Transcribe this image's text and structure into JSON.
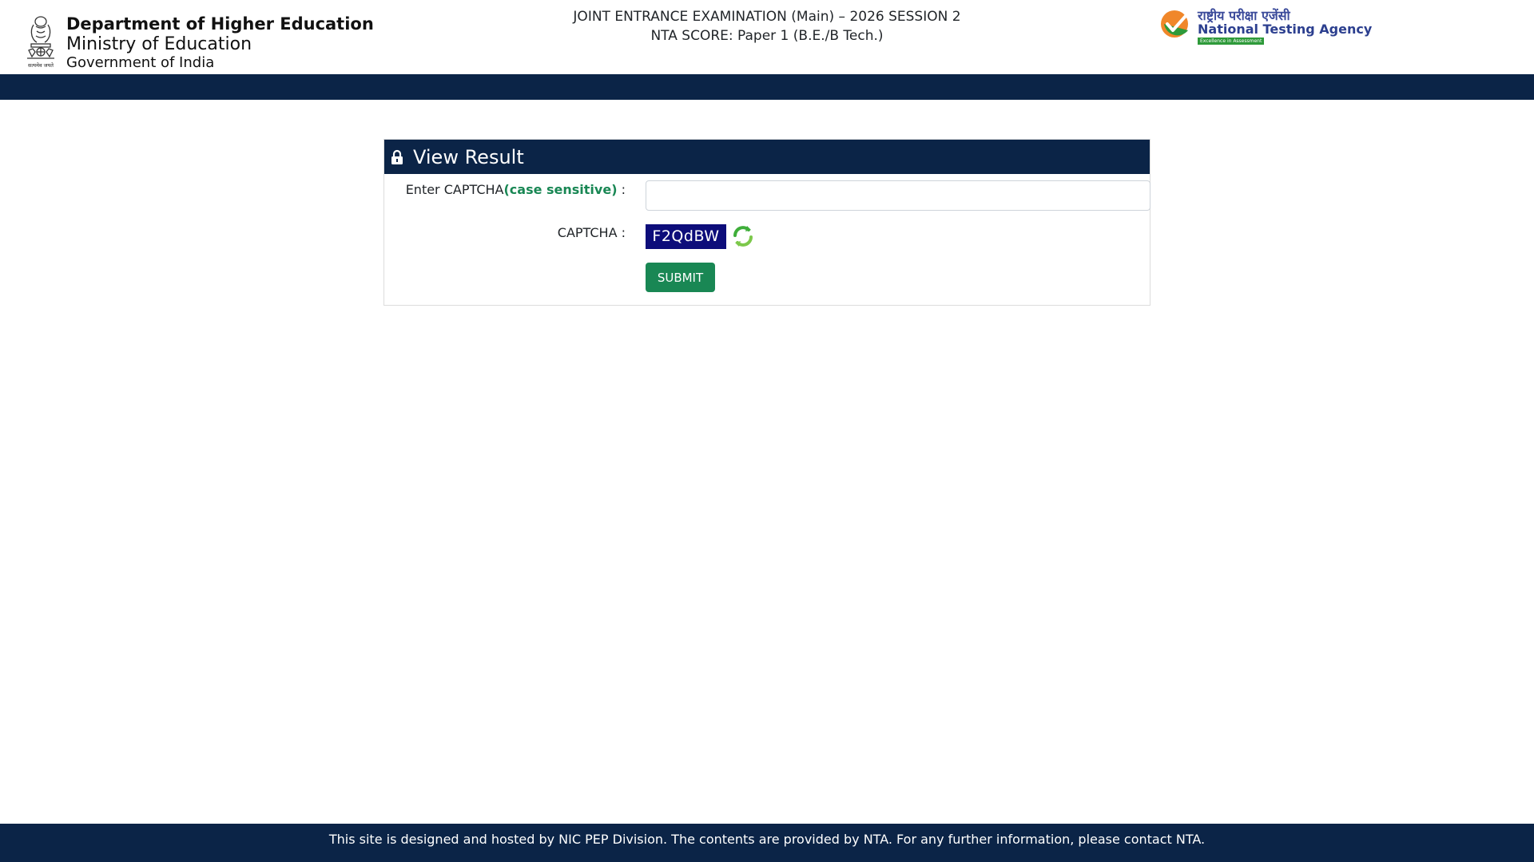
{
  "header": {
    "department": "Department of Higher Education",
    "ministry": "Ministry of Education",
    "government": "Government of India",
    "exam_title": "JOINT ENTRANCE EXAMINATION (Main) – 2026 SESSION 2",
    "exam_subtitle": "NTA SCORE: Paper 1 (B.E./B Tech.)",
    "emblem_motto": "सत्यमेव जयते",
    "nta_hindi": "राष्ट्रीय परीक्षा एजेंसी",
    "nta_english": "National Testing Agency",
    "nta_tagline": "Excellence in Assessment"
  },
  "card": {
    "title": "View Result",
    "captcha_input_label": "Enter CAPTCHA",
    "case_note": "(case sensitive)",
    "label_suffix": " :",
    "captcha_input_value": "",
    "captcha_input_placeholder": "",
    "captcha_label": "CAPTCHA :",
    "captcha_text": "F2QdBW",
    "submit_label": "SUBMIT"
  },
  "footer": {
    "text": "This site is designed and hosted by NIC PEP Division. The contents are provided by NTA. For any further information, please contact NTA."
  },
  "colors": {
    "navy": "#0b2447",
    "green": "#198754",
    "captcha_bg": "#0d0d7a",
    "nta_blue": "#2c3f8f"
  },
  "icons": {
    "emblem": "state-emblem-icon",
    "nta_logo": "nta-checkmark-logo",
    "lock": "lock-icon",
    "refresh": "refresh-icon"
  }
}
